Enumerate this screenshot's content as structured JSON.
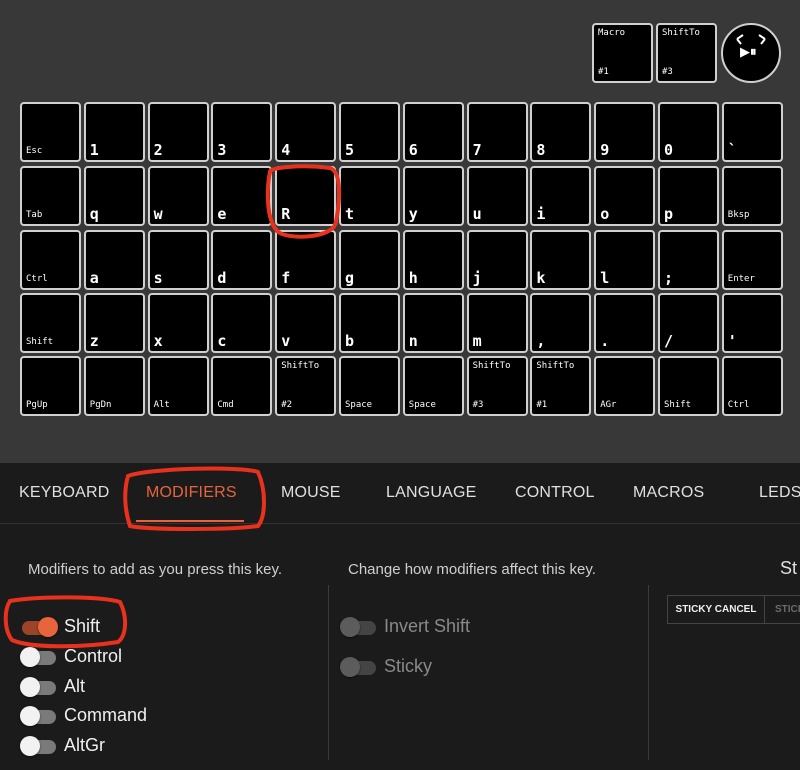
{
  "keyboard": {
    "top_keys": [
      {
        "top": "Macro",
        "bottom": "#1"
      },
      {
        "top": "ShiftTo",
        "bottom": "#3"
      }
    ],
    "knob": {
      "icon": "play-pause-icon",
      "glyph": "▶⏸"
    },
    "rows": [
      [
        "Esc",
        "1",
        "2",
        "3",
        "4",
        "5",
        "6",
        "7",
        "8",
        "9",
        "0",
        "`"
      ],
      [
        "Tab",
        "q",
        "w",
        "e",
        "R",
        "t",
        "y",
        "u",
        "i",
        "o",
        "p",
        "Bksp"
      ],
      [
        "Ctrl",
        "a",
        "s",
        "d",
        "f",
        "g",
        "h",
        "j",
        "k",
        "l",
        ";",
        "Enter"
      ],
      [
        "Shift",
        "z",
        "x",
        "c",
        "v",
        "b",
        "n",
        "m",
        ",",
        ".",
        "/",
        "'"
      ],
      [
        "PgUp",
        "PgDn",
        "Alt",
        "Cmd",
        "ShiftTo|#2",
        "Space",
        "Space",
        "ShiftTo|#3",
        "ShiftTo|#1",
        "AGr",
        "Shift",
        "Ctrl"
      ]
    ]
  },
  "tabs": [
    "KEYBOARD",
    "MODIFIERS",
    "MOUSE",
    "LANGUAGE",
    "CONTROL",
    "MACROS",
    "LEDS"
  ],
  "active_tab": "MODIFIERS",
  "modifiers": {
    "description": "Modifiers to add as you press this key.",
    "items": [
      {
        "label": "Shift",
        "on": true
      },
      {
        "label": "Control",
        "on": false
      },
      {
        "label": "Alt",
        "on": false
      },
      {
        "label": "Command",
        "on": false
      },
      {
        "label": "AltGr",
        "on": false
      }
    ]
  },
  "behavior": {
    "description": "Change how modifiers affect this key.",
    "items": [
      {
        "label": "Invert Shift",
        "on": false
      },
      {
        "label": "Sticky",
        "on": false
      }
    ]
  },
  "sticky": {
    "title": "St",
    "buttons": [
      "STICKY CANCEL",
      "STICK"
    ]
  },
  "colors": {
    "accent": "#e8643c",
    "annotation": "#e8321e"
  }
}
